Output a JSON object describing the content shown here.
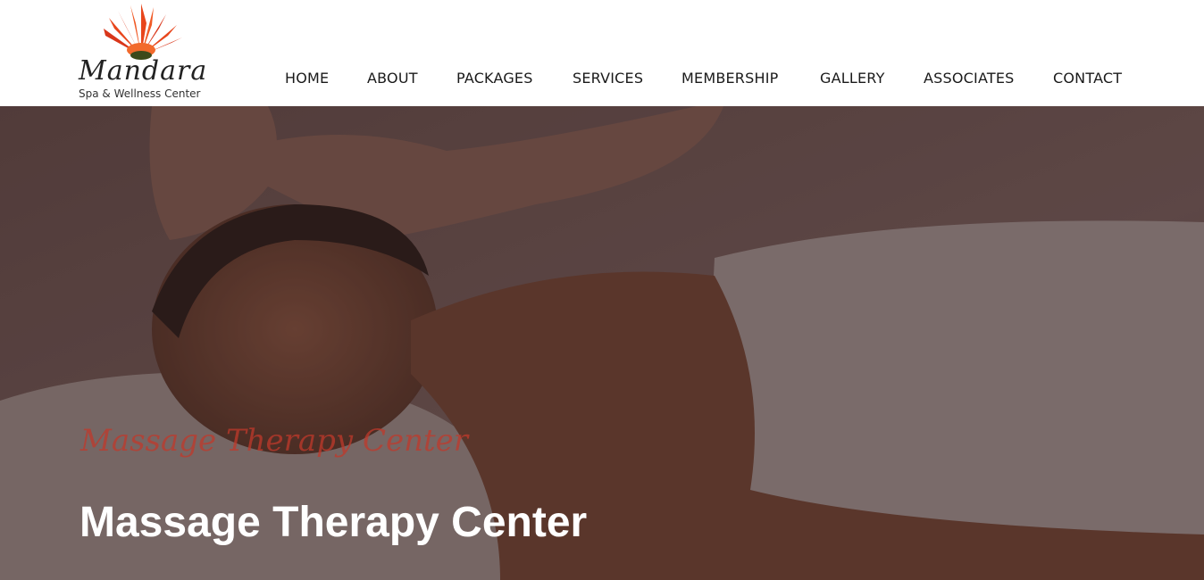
{
  "brand": {
    "name": "Mandara",
    "tagline": "Spa & Wellness Center",
    "logo_icon": "flower-icon",
    "flower_color": "#e8461c"
  },
  "nav": {
    "items": [
      {
        "label": "HOME"
      },
      {
        "label": "ABOUT"
      },
      {
        "label": "PACKAGES"
      },
      {
        "label": "SERVICES"
      },
      {
        "label": "MEMBERSHIP"
      },
      {
        "label": "GALLERY"
      },
      {
        "label": "ASSOCIATES"
      },
      {
        "label": "CONTACT"
      }
    ]
  },
  "hero": {
    "script_text": "Massage Therapy Center",
    "title": "Massage Therapy Center",
    "image_subject": "massage-photo",
    "overlay_color": "#3a2a2a",
    "script_color": "#c0392b"
  }
}
